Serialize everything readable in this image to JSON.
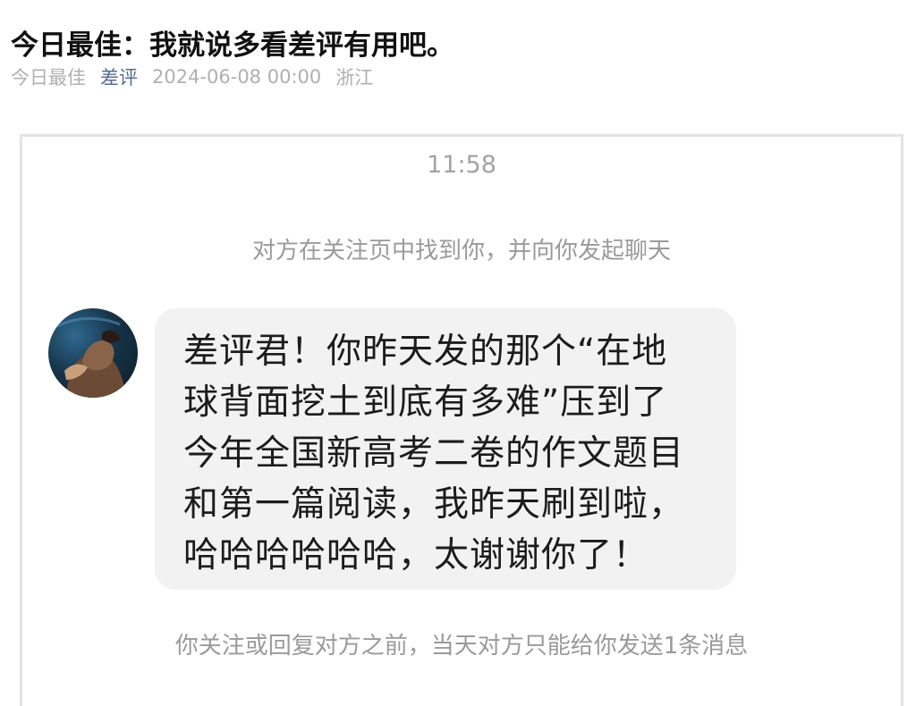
{
  "article": {
    "title": "今日最佳：我就说多看差评有用吧。",
    "meta": {
      "column": "今日最佳",
      "author": "差评",
      "datetime": "2024-06-08 00:00",
      "location": "浙江"
    }
  },
  "chat": {
    "time": "11:58",
    "notice_top": "对方在关注页中找到你，并向你发起聊天",
    "message": {
      "avatar_icon": "user-avatar-icon",
      "lines": [
        "差评君！你昨天发的那个“在地",
        "球背面挖土到底有多难”压到了",
        "今年全国新高考二卷的作文题目",
        "和第一篇阅读，我昨天刷到啦，",
        "哈哈哈哈哈哈，太谢谢你了！"
      ]
    },
    "notice_bottom": "你关注或回复对方之前，当天对方只能给你发送1条消息"
  },
  "colors": {
    "author_link": "#576b95",
    "meta_text": "#b0b0b0",
    "bubble_bg": "#f2f2f2",
    "system_text": "#9a9a9a"
  }
}
